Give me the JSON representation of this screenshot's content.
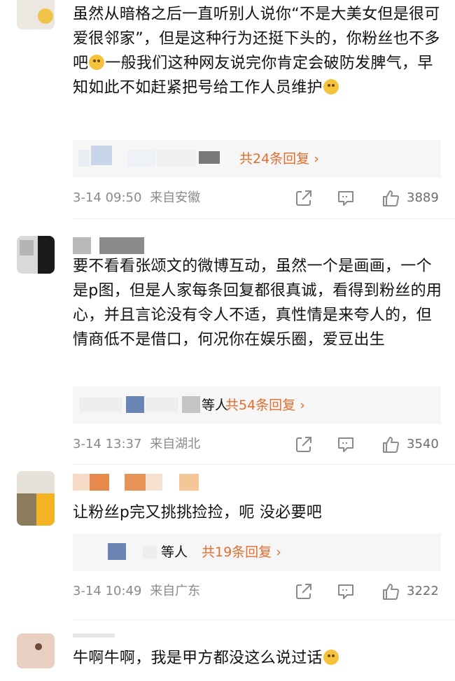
{
  "comments": [
    {
      "text_parts": [
        "虽然从暗格之后一直听别人说你“不是大美女但是很可爱很邻家”，但是这种行为还挺下头的，你粉丝也不多吧",
        "一般我们这种网友说完你肯定会破防发脾气，早知如此不如赶紧把号给工作人员维护",
        ""
      ],
      "reply_prefix": "",
      "reply_link": "共24条回复 ›",
      "time": "3-14 09:50",
      "location": "来自安徽",
      "likes": "3889"
    },
    {
      "text_parts": [
        "要不看看张颂文的微博互动，虽然一个是画画，一个是p图，但是人家每条回复都很真诚，看得到粉丝的用心，并且言论没有令人不适，真性情是来夸人的，但情商低不是借口，何况你在娱乐圈，爱豆出生"
      ],
      "reply_prefix": "等人",
      "reply_link": "共54条回复 ›",
      "time": "3-14 13:37",
      "location": "来自湖北",
      "likes": "3540"
    },
    {
      "text_parts": [
        "让粉丝p完又挑挑捡捡，呃 没必要吧"
      ],
      "reply_prefix": "等人",
      "reply_link": "共19条回复 ›",
      "time": "3-14 10:49",
      "location": "来自广东",
      "likes": "3222"
    },
    {
      "text_parts": [
        "牛啊牛啊，我是甲方都没这么说过话"
      ]
    }
  ],
  "icons": {
    "share": "share-icon",
    "comment": "comment-icon",
    "like": "thumbs-up-icon",
    "emoji": "emoji-icon"
  },
  "colors": {
    "reply_link": "#e06e2f",
    "meta": "#8a8a8a",
    "reply_bg": "#f6f6f6"
  }
}
